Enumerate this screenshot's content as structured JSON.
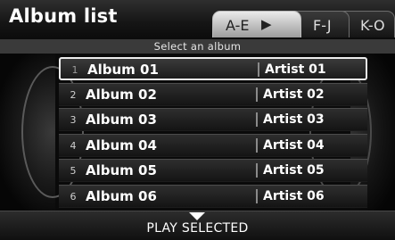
{
  "header": {
    "title": "Album list",
    "tabs": [
      {
        "label": "A-E",
        "active": true
      },
      {
        "label": "F-J",
        "active": false
      },
      {
        "label": "K-O",
        "active": false
      }
    ],
    "subtitle": "Select an album"
  },
  "albums": [
    {
      "num": "1",
      "album": "Album 01",
      "artist": "Artist 01",
      "selected": true
    },
    {
      "num": "2",
      "album": "Album 02",
      "artist": "Artist 02",
      "selected": false
    },
    {
      "num": "3",
      "album": "Album 03",
      "artist": "Artist 03",
      "selected": false
    },
    {
      "num": "4",
      "album": "Album 04",
      "artist": "Artist 04",
      "selected": false
    },
    {
      "num": "5",
      "album": "Album 05",
      "artist": "Artist 05",
      "selected": false
    },
    {
      "num": "6",
      "album": "Album 06",
      "artist": "Artist 06",
      "selected": false
    }
  ],
  "footer": {
    "play_label": "PLAY SELECTED",
    "icon": "down-arrow-icon"
  }
}
